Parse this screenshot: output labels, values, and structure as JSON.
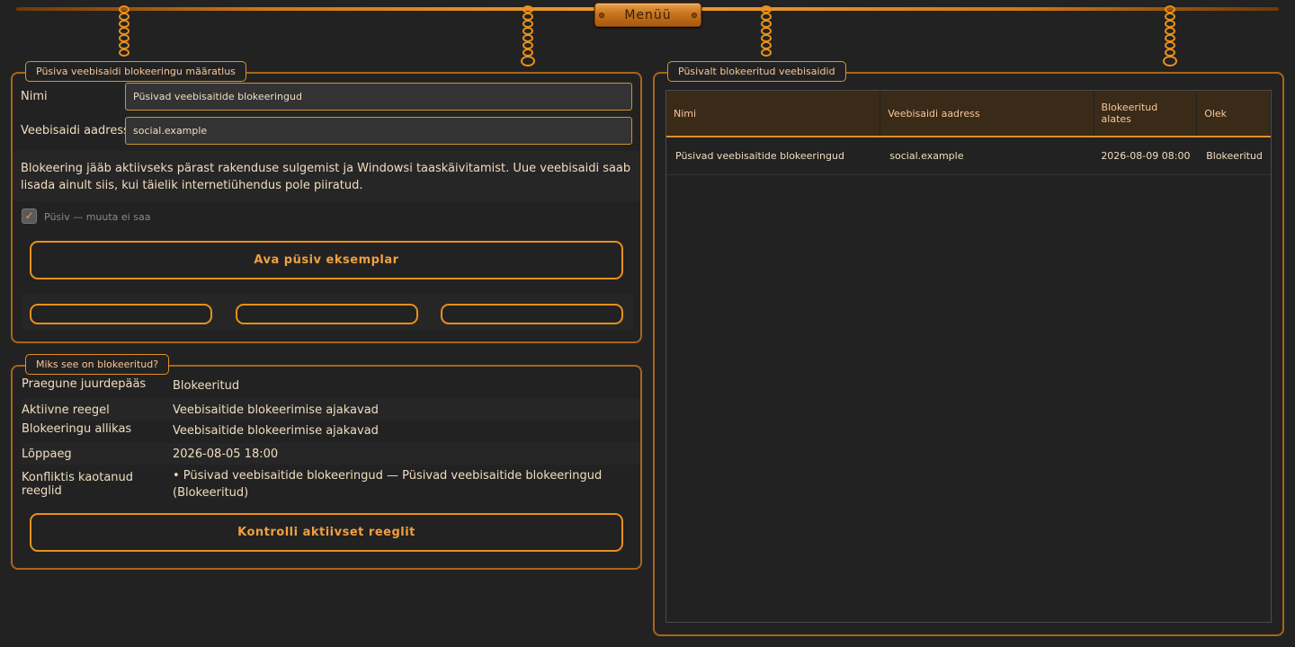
{
  "menu": {
    "label": "Menüü"
  },
  "definition_panel": {
    "title": "Püsiva veebisaidi blokeeringu määratlus",
    "name_label": "Nimi",
    "name_value": "Püsivad veebisaitide blokeeringud",
    "address_label": "Veebisaidi aadress",
    "address_value": "social.example",
    "info_text": "Blokeering jääb aktiivseks pärast rakenduse sulgemist ja Windowsi taaskäivitamist. Uue veebisaidi saab lisada ainult siis, kui täielik internetiühendus pole piiratud.",
    "permanent_checkbox_label": "Püsiv — muuta ei saa",
    "permanent_checked": true,
    "open_button_label": "Ava püsiv eksemplar"
  },
  "reason_panel": {
    "title": "Miks see on blokeeritud?",
    "rows": [
      {
        "key": "Praegune juurdepääs",
        "value": "Blokeeritud"
      },
      {
        "key": "Aktiivne reegel",
        "value": "Veebisaitide blokeerimise ajakavad"
      },
      {
        "key": "Blokeeringu allikas",
        "value": "Veebisaitide blokeerimise ajakavad"
      },
      {
        "key": "Lõppaeg",
        "value": "2026-08-05 18:00"
      },
      {
        "key": "Konfliktis kaotanud reeglid",
        "value": "• Püsivad veebisaitide blokeeringud — Püsivad veebisaitide blokeeringud (Blokeeritud)"
      }
    ],
    "check_button_label": "Kontrolli aktiivset reeglit"
  },
  "blocked_panel": {
    "title": "Püsivalt blokeeritud veebisaidid",
    "columns": [
      "Nimi",
      "Veebisaidi aadress",
      "Blokeeritud alates",
      "Olek"
    ],
    "rows": [
      [
        "Püsivad veebisaitide blokeeringud",
        "social.example",
        "2026-08-09 08:00",
        "Blokeeritud"
      ]
    ]
  },
  "colors": {
    "accent": "#e8901c",
    "background": "#222222",
    "header_bg": "#3a2a18"
  }
}
